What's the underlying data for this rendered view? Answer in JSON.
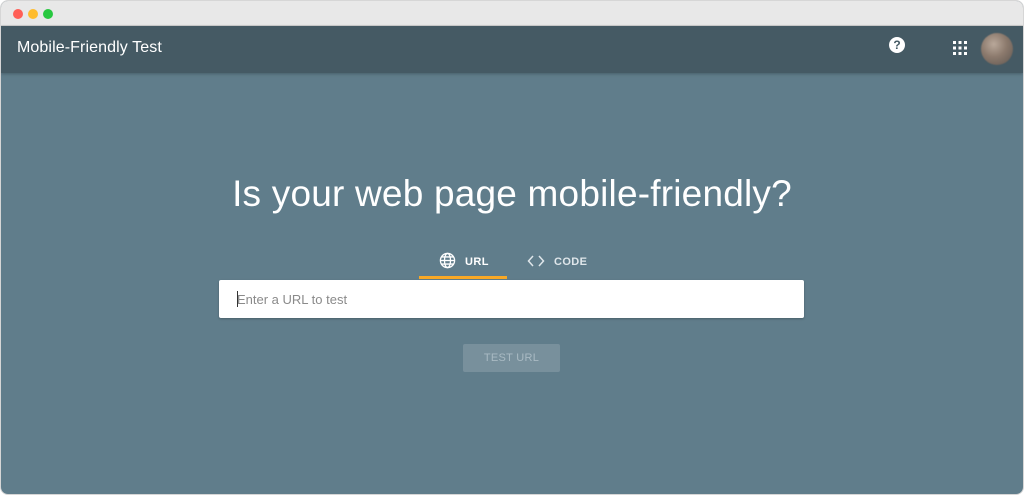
{
  "app": {
    "title": "Mobile-Friendly Test"
  },
  "header": {
    "help_glyph": "?",
    "icons": [
      "help-icon",
      "apps-grid-icon",
      "avatar"
    ]
  },
  "main": {
    "headline": "Is your web page mobile-friendly?",
    "tabs": [
      {
        "label": "URL",
        "icon": "globe-icon",
        "selected": true
      },
      {
        "label": "CODE",
        "icon": "code-brackets-icon",
        "selected": false
      }
    ],
    "url_input": {
      "value": "",
      "placeholder": "Enter a URL to test"
    },
    "test_button": {
      "label": "TEST URL",
      "enabled": false
    }
  },
  "colors": {
    "appbar": "#455a64",
    "background": "#607d8b",
    "tab_indicator": "#f9a825",
    "button_disabled": "#78909c"
  }
}
